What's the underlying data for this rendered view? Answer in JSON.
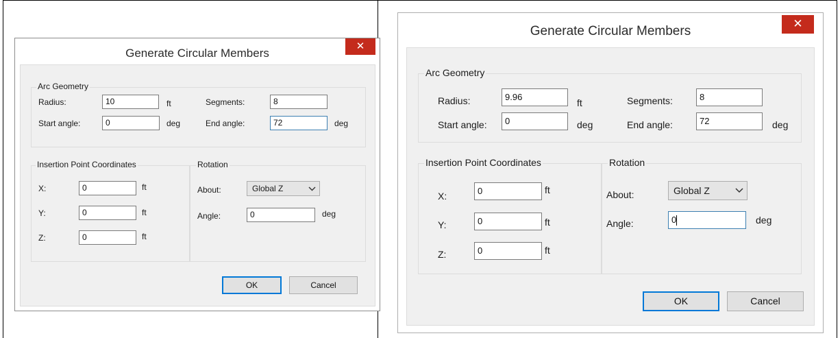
{
  "dialog_left": {
    "title": "Generate Circular Members",
    "close_glyph": "✕",
    "arc_geometry": {
      "group_label": "Arc Geometry",
      "radius_label": "Radius:",
      "radius_value": "10",
      "radius_unit": "ft",
      "segments_label": "Segments:",
      "segments_value": "8",
      "start_angle_label": "Start angle:",
      "start_angle_value": "0",
      "start_angle_unit": "deg",
      "end_angle_label": "End angle:",
      "end_angle_value": "72",
      "end_angle_unit": "deg"
    },
    "insertion": {
      "group_label": "Insertion Point Coordinates",
      "x_label": "X:",
      "x_value": "0",
      "x_unit": "ft",
      "y_label": "Y:",
      "y_value": "0",
      "y_unit": "ft",
      "z_label": "Z:",
      "z_value": "0",
      "z_unit": "ft"
    },
    "rotation": {
      "group_label": "Rotation",
      "about_label": "About:",
      "about_value": "Global Z",
      "angle_label": "Angle:",
      "angle_value": "0",
      "angle_unit": "deg"
    },
    "ok_label": "OK",
    "cancel_label": "Cancel"
  },
  "dialog_right": {
    "title": "Generate Circular Members",
    "close_glyph": "✕",
    "arc_geometry": {
      "group_label": "Arc Geometry",
      "radius_label": "Radius:",
      "radius_value": "9.96",
      "radius_unit": "ft",
      "segments_label": "Segments:",
      "segments_value": "8",
      "start_angle_label": "Start angle:",
      "start_angle_value": "0",
      "start_angle_unit": "deg",
      "end_angle_label": "End angle:",
      "end_angle_value": "72",
      "end_angle_unit": "deg"
    },
    "insertion": {
      "group_label": "Insertion Point Coordinates",
      "x_label": "X:",
      "x_value": "0",
      "x_unit": "ft",
      "y_label": "Y:",
      "y_value": "0",
      "y_unit": "ft",
      "z_label": "Z:",
      "z_value": "0",
      "z_unit": "ft"
    },
    "rotation": {
      "group_label": "Rotation",
      "about_label": "About:",
      "about_value": "Global Z",
      "angle_label": "Angle:",
      "angle_value": "0",
      "angle_unit": "deg"
    },
    "ok_label": "OK",
    "cancel_label": "Cancel"
  },
  "icons": {
    "close": "close-icon",
    "dropdown": "chevron-down-icon"
  },
  "colors": {
    "close_button": "#c42b1c",
    "focus_border": "#3c7fb1",
    "default_button_border": "#0078d7",
    "dialog_client": "#f0f0f0"
  }
}
